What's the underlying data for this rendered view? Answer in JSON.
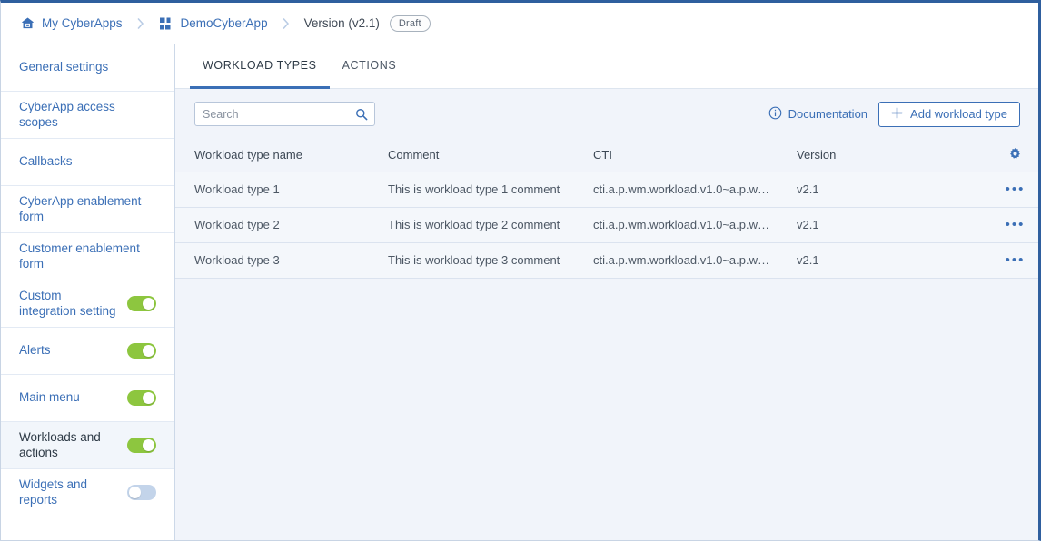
{
  "breadcrumb": {
    "items": [
      {
        "label": "My CyberApps",
        "icon": "home-icon",
        "link": true
      },
      {
        "label": "DemoCyberApp",
        "icon": "grid-icon",
        "link": true
      },
      {
        "label": "Version (v2.1)",
        "icon": "",
        "link": false
      }
    ],
    "separator": "›",
    "status_badge": "Draft"
  },
  "sidebar": {
    "items": [
      {
        "label": "General settings",
        "toggle": null,
        "active": false
      },
      {
        "label": "CyberApp access scopes",
        "toggle": null,
        "active": false
      },
      {
        "label": "Callbacks",
        "toggle": null,
        "active": false
      },
      {
        "label": "CyberApp enablement form",
        "toggle": null,
        "active": false
      },
      {
        "label": "Customer enablement form",
        "toggle": null,
        "active": false
      },
      {
        "label": "Custom integration setting",
        "toggle": "on",
        "active": false
      },
      {
        "label": "Alerts",
        "toggle": "on",
        "active": false
      },
      {
        "label": "Main menu",
        "toggle": "on",
        "active": false
      },
      {
        "label": "Workloads and actions",
        "toggle": "on",
        "active": true
      },
      {
        "label": "Widgets and reports",
        "toggle": "off",
        "active": false
      }
    ]
  },
  "main": {
    "tabs": [
      {
        "label": "WORKLOAD TYPES",
        "active": true
      },
      {
        "label": "ACTIONS",
        "active": false
      }
    ],
    "toolbar": {
      "search_placeholder": "Search",
      "search_value": "",
      "search_icon": "search-icon",
      "documentation_label": "Documentation",
      "documentation_icon": "info-circle-icon",
      "add_label": "Add workload type",
      "add_icon": "plus-icon",
      "settings_icon": "gear-icon"
    },
    "table": {
      "columns": [
        "Workload type name",
        "Comment",
        "CTI",
        "Version"
      ],
      "row_menu_icon": "ellipsis-icon",
      "rows": [
        {
          "name": "Workload type 1",
          "comment": "This is workload type 1 comment",
          "cti": "cti.a.p.wm.workload.v1.0~a.p.wm....",
          "version": "v2.1"
        },
        {
          "name": "Workload type 2",
          "comment": "This is workload type 2 comment",
          "cti": "cti.a.p.wm.workload.v1.0~a.p.wm....",
          "version": "v2.1"
        },
        {
          "name": "Workload type 3",
          "comment": "This is workload type 3 comment",
          "cti": "cti.a.p.wm.workload.v1.0~a.p.wm....",
          "version": "v2.1"
        }
      ]
    }
  },
  "colors": {
    "accent": "#3b6fb6",
    "toggle_on": "#8dc63f",
    "toggle_off": "#c3d4ea",
    "panel_bg": "#f1f4fa",
    "frame_border": "#2f5f9e"
  }
}
